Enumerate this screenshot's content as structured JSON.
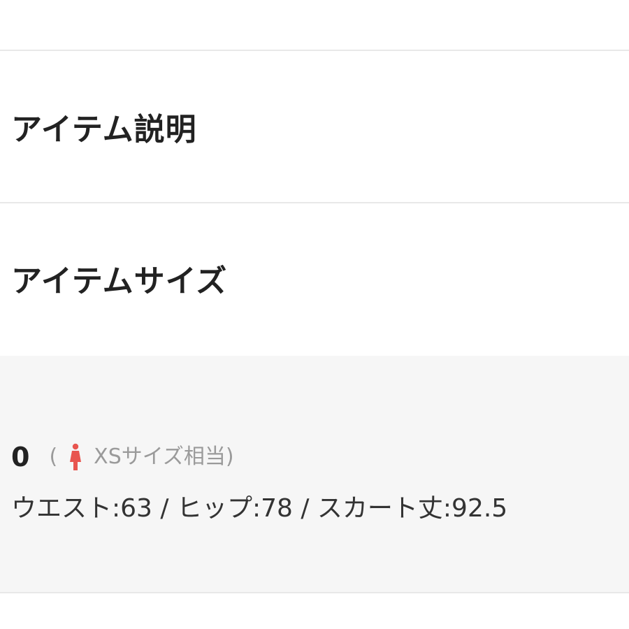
{
  "sections": {
    "description_title": "アイテム説明",
    "size_title": "アイテムサイズ"
  },
  "size_entry": {
    "code": "0",
    "equivalent_open": "(",
    "equivalent_label": "XSサイズ相当",
    "equivalent_close": ")",
    "icon": "woman-icon",
    "measurements": "ウエスト:63 / ヒップ:78 / スカート丈:92.5"
  },
  "colors": {
    "accent_icon": "#e8554f",
    "panel_background": "#f6f6f6",
    "divider": "#e8e8e8"
  }
}
